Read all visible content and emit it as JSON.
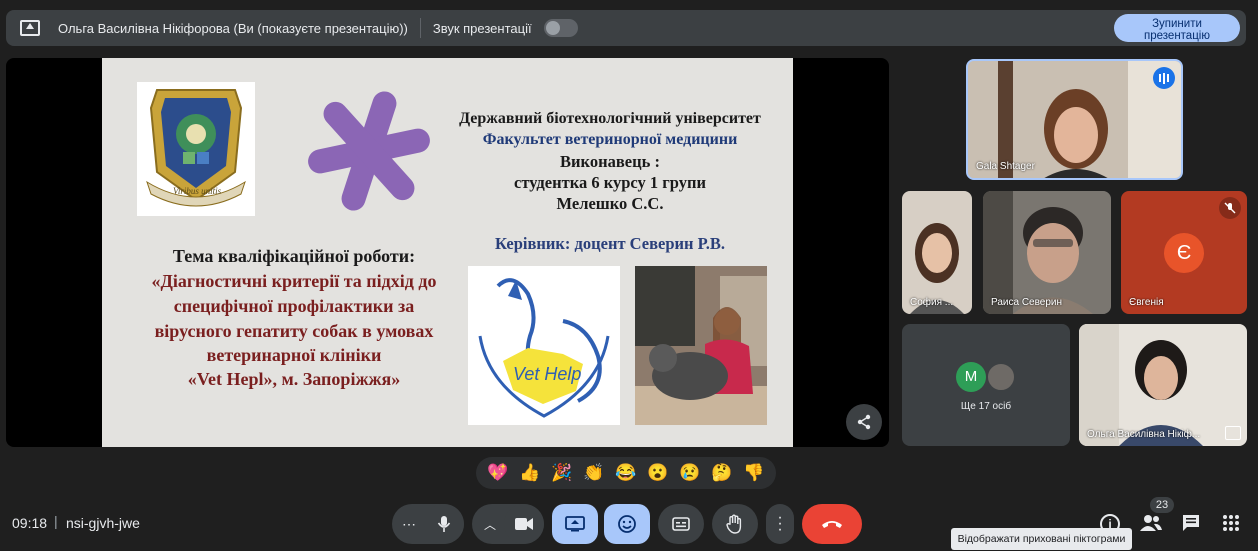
{
  "topbar": {
    "presenter": "Ольга Василівна Нікіфорова (Ви (показуєте презентацію))",
    "sound_label": "Звук презентації",
    "stop_line1": "Зупинити",
    "stop_line2": "презентацію"
  },
  "slide": {
    "logo_motto": "Viribus unitis",
    "university": "Державний біотехнологічний університет",
    "faculty": "Факультет ветеринорної медицини",
    "performer": "Виконавець :",
    "student": "студентка 6 курсу 1 групи",
    "name": "Мелешко С.С.",
    "supervisor": "Керівник: доцент Северин Р.В.",
    "topic_heading": "Тема кваліфікаційної  роботи:",
    "topic_lines": [
      "«Діагностичні критерії та підхід до",
      "специфічної профілактики за",
      "вірусного гепатиту  собак в умовах",
      "ветеринарної клініки",
      "«Vet Hepl», м. Запоріжжя»"
    ],
    "vethelp_logo_text": "Vet Help"
  },
  "participants": {
    "featured": "Gala Shtager",
    "p1": "София ...",
    "p2": "Раиса Северин",
    "p3": "Євгенія",
    "p3_initial": "Є",
    "others_initial": "M",
    "others_label": "Ще 17 осіб",
    "self": "Ольга Василівна Нікіф..."
  },
  "reactions": [
    "💖",
    "👍",
    "🎉",
    "👏",
    "😂",
    "😮",
    "😢",
    "🤔",
    "👎"
  ],
  "bottom": {
    "time": "09:18",
    "separator": "|",
    "meeting_code": "nsi-gjvh-jwe",
    "participants_count": "23",
    "tooltip": "Відображати приховані піктограми"
  },
  "colors": {
    "stop_button": "#a8c7fa",
    "end_call": "#ea4335",
    "active_control": "#a8c7fa",
    "star": "#8b66b5",
    "avatar_ye": "#e8542a",
    "avatar_m": "#2e9e57"
  }
}
